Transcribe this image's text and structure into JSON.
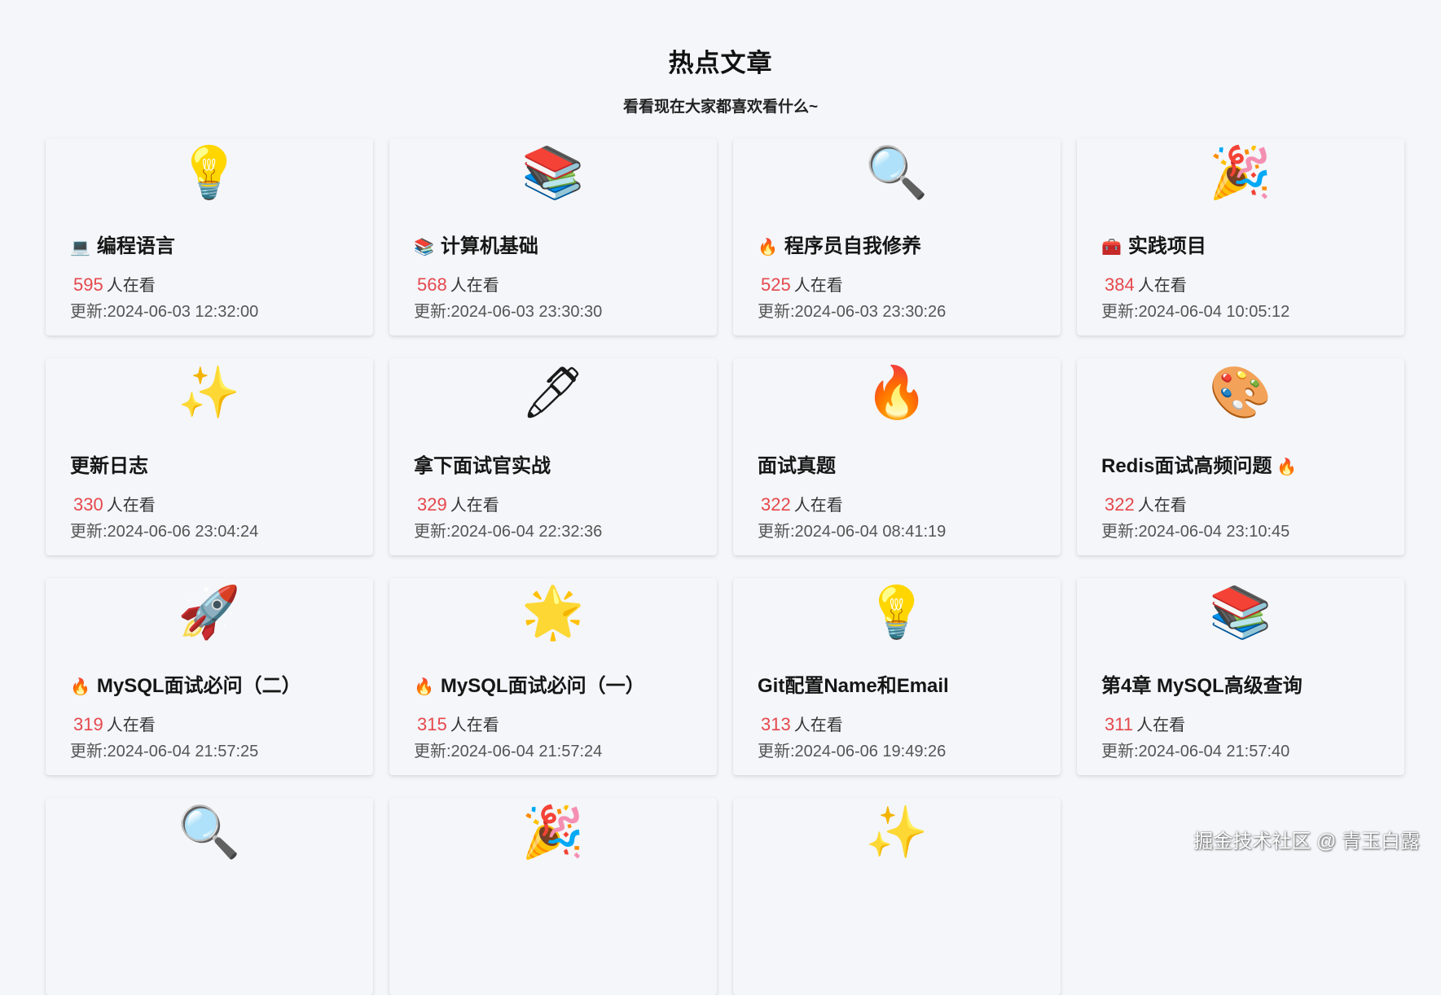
{
  "header": {
    "title": "热点文章",
    "subtitle": "看看现在大家都喜欢看什么~"
  },
  "colors": {
    "background": "#f4f6f9",
    "view_count": "#e5484d"
  },
  "cards": [
    {
      "icon": "💡",
      "icon_name": "lightbulb-icon",
      "prefix": "💻",
      "prefix_name": "laptop-icon",
      "title": "编程语言",
      "suffix": "",
      "count": "595",
      "count_label": "人在看",
      "updated": "更新:2024-06-03 12:32:00"
    },
    {
      "icon": "📚",
      "icon_name": "books-icon",
      "prefix": "📚",
      "prefix_name": "books-icon",
      "title": "计算机基础",
      "suffix": "",
      "count": "568",
      "count_label": "人在看",
      "updated": "更新:2024-06-03 23:30:30"
    },
    {
      "icon": "🔍",
      "icon_name": "magnifier-icon",
      "prefix": "🔥",
      "prefix_name": "fire-icon",
      "title": "程序员自我修养",
      "suffix": "",
      "count": "525",
      "count_label": "人在看",
      "updated": "更新:2024-06-03 23:30:26"
    },
    {
      "icon": "🎉",
      "icon_name": "party-popper-icon",
      "prefix": "🧰",
      "prefix_name": "toolbox-icon",
      "title": "实践项目",
      "suffix": "",
      "count": "384",
      "count_label": "人在看",
      "updated": "更新:2024-06-04 10:05:12"
    },
    {
      "icon": "✨",
      "icon_name": "sparkles-icon",
      "prefix": "",
      "prefix_name": "",
      "title": "更新日志",
      "suffix": "",
      "count": "330",
      "count_label": "人在看",
      "updated": "更新:2024-06-06 23:04:24"
    },
    {
      "icon": "🖊",
      "icon_name": "pen-icon",
      "prefix": "",
      "prefix_name": "",
      "title": "拿下面试官实战",
      "suffix": "",
      "count": "329",
      "count_label": "人在看",
      "updated": "更新:2024-06-04 22:32:36"
    },
    {
      "icon": "🔥",
      "icon_name": "fire-icon",
      "prefix": "",
      "prefix_name": "",
      "title": "面试真题",
      "suffix": "",
      "count": "322",
      "count_label": "人在看",
      "updated": "更新:2024-06-04 08:41:19"
    },
    {
      "icon": "🎨",
      "icon_name": "palette-icon",
      "prefix": "",
      "prefix_name": "",
      "title": "Redis面试高频问题",
      "suffix": "🔥",
      "suffix_name": "fire-icon",
      "count": "322",
      "count_label": "人在看",
      "updated": "更新:2024-06-04 23:10:45"
    },
    {
      "icon": "🚀",
      "icon_name": "rocket-icon",
      "prefix": "🔥",
      "prefix_name": "fire-icon",
      "title": "MySQL面试必问（二）",
      "suffix": "",
      "count": "319",
      "count_label": "人在看",
      "updated": "更新:2024-06-04 21:57:25"
    },
    {
      "icon": "🌟",
      "icon_name": "star-icon",
      "prefix": "🔥",
      "prefix_name": "fire-icon",
      "title": "MySQL面试必问（一）",
      "suffix": "",
      "count": "315",
      "count_label": "人在看",
      "updated": "更新:2024-06-04 21:57:24"
    },
    {
      "icon": "💡",
      "icon_name": "lightbulb-icon",
      "prefix": "",
      "prefix_name": "",
      "title": "Git配置Name和Email",
      "suffix": "",
      "count": "313",
      "count_label": "人在看",
      "updated": "更新:2024-06-06 19:49:26"
    },
    {
      "icon": "📚",
      "icon_name": "books-icon",
      "prefix": "",
      "prefix_name": "",
      "title": "第4章 MySQL高级查询",
      "suffix": "",
      "count": "311",
      "count_label": "人在看",
      "updated": "更新:2024-06-04 21:57:40"
    },
    {
      "icon": "🔍",
      "icon_name": "magnifier-icon",
      "prefix": "",
      "prefix_name": "",
      "title": "",
      "suffix": "",
      "count": "",
      "count_label": "",
      "updated": ""
    },
    {
      "icon": "🎉",
      "icon_name": "party-popper-icon",
      "prefix": "",
      "prefix_name": "",
      "title": "",
      "suffix": "",
      "count": "",
      "count_label": "",
      "updated": ""
    },
    {
      "icon": "✨",
      "icon_name": "sparkles-icon",
      "prefix": "",
      "prefix_name": "",
      "title": "",
      "suffix": "",
      "count": "",
      "count_label": "",
      "updated": ""
    }
  ],
  "watermark": "掘金技术社区 @ 青玉白露"
}
